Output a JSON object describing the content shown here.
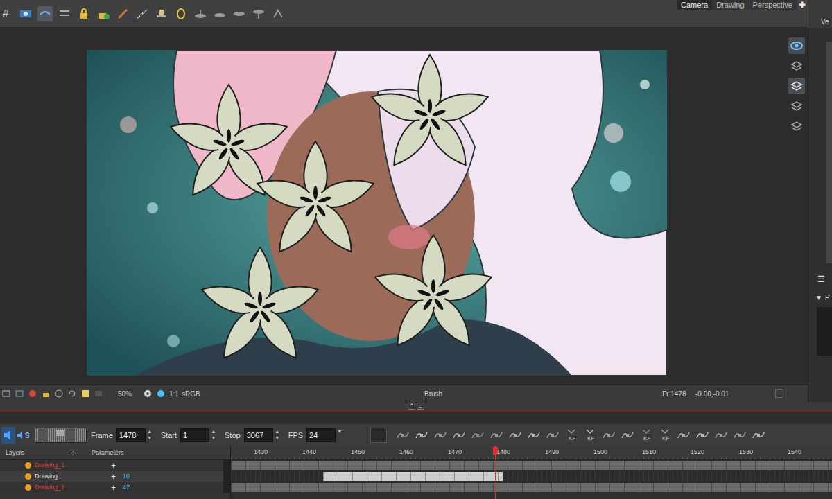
{
  "toolbar": {
    "grid": "#"
  },
  "view_tabs": [
    {
      "label": "Camera",
      "selected": true
    },
    {
      "label": "Drawing",
      "selected": false
    },
    {
      "label": "Perspective",
      "selected": false
    }
  ],
  "view_actions": [
    "✚"
  ],
  "right_panel": {
    "title": "Ve",
    "menu": "☰",
    "section_arrow": "▼",
    "section": "P"
  },
  "status_bar": {
    "zoom": "50%",
    "ratio": "1:1",
    "color_space": "sRGB",
    "tool": "Brush",
    "frame": "Fr 1478",
    "coords": "-0.00,-0.01"
  },
  "splitter": {
    "up": "⌃",
    "down": "⌄"
  },
  "playback": {
    "sound_on": true,
    "sound_label": "S",
    "frame_label": "Frame",
    "frame": "1478",
    "start_label": "Start",
    "start": "1",
    "stop_label": "Stop",
    "stop": "3067",
    "fps_label": "FPS",
    "fps": "24"
  },
  "timeline_tools": {
    "keyframe_labels": [
      "KF",
      "KF",
      "KF",
      "KF"
    ]
  },
  "timeline": {
    "layers_label": "Layers",
    "add": "+",
    "parameters_label": "Parameters",
    "ruler": [
      "1430",
      "1440",
      "1450",
      "1460",
      "1470",
      "1480",
      "1490",
      "1500",
      "1510",
      "1520",
      "1530",
      "1540"
    ],
    "view_start": 1424,
    "current_frame": 1478,
    "layers": [
      {
        "name": "Drawing_1",
        "color": "#e03a3a",
        "parameter": "",
        "selected": false,
        "segments": [
          {
            "from": 1424,
            "to": 1549,
            "selected": false
          }
        ]
      },
      {
        "name": "Drawing",
        "color": "#e8e8e8",
        "parameter": "10",
        "selected": true,
        "segments": [
          {
            "from": 1443,
            "to": 1479,
            "selected": true
          }
        ]
      },
      {
        "name": "Drawing_2",
        "color": "#e03a3a",
        "parameter": "47",
        "selected": false,
        "segments": [
          {
            "from": 1424,
            "to": 1549,
            "selected": false
          }
        ]
      }
    ]
  }
}
